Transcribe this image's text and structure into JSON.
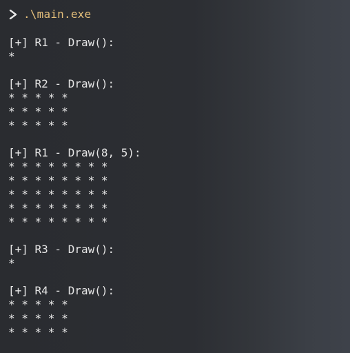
{
  "terminal": {
    "prompt_command": ".\\main.exe",
    "icons": {
      "prompt": "chevron-right-icon"
    },
    "colors": {
      "command": "#e6c07b",
      "text": "#e6e6e6",
      "background": "#2a2c30"
    }
  },
  "output": {
    "blocks": [
      {
        "title": "[+] R1 - Draw():",
        "rows": [
          "*"
        ]
      },
      {
        "title": "[+] R2 - Draw():",
        "rows": [
          "* * * * *",
          "* * * * *",
          "* * * * *"
        ]
      },
      {
        "title": "[+] R1 - Draw(8, 5):",
        "rows": [
          "* * * * * * * *",
          "* * * * * * * *",
          "* * * * * * * *",
          "* * * * * * * *",
          "* * * * * * * *"
        ]
      },
      {
        "title": "[+] R3 - Draw():",
        "rows": [
          "*"
        ]
      },
      {
        "title": "[+] R4 - Draw():",
        "rows": [
          "* * * * *",
          "* * * * *",
          "* * * * *"
        ]
      }
    ]
  }
}
